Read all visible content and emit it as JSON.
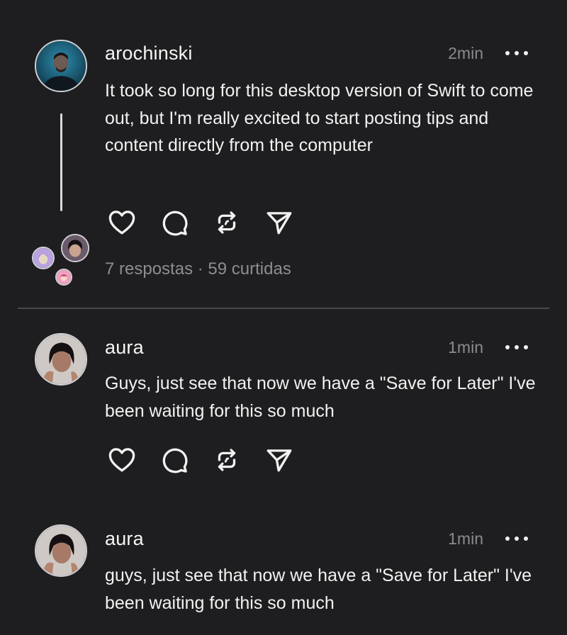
{
  "posts": [
    {
      "username": "arochinski",
      "time": "2min",
      "text": "It took so long for this desktop version of Swift to come out, but I'm really excited to start posting tips and content directly from the computer",
      "stats": {
        "replies": "7 respostas",
        "separator": "·",
        "likes": "59 curtidas"
      }
    },
    {
      "username": "aura",
      "time": "1min",
      "text": "Guys, just see that now we have a \"Save for Later\" I've been waiting for this so much"
    },
    {
      "username": "aura",
      "time": "1min",
      "text": "guys, just see that now we have a \"Save for Later\" I've been waiting for this so much"
    }
  ],
  "icons": {
    "like": "heart-icon",
    "reply": "comment-icon",
    "repost": "repost-icon",
    "share": "send-icon",
    "more": "more-horizontal-icon"
  },
  "colors": {
    "background": "#1e1e20",
    "text": "#f2f2f2",
    "muted": "#8a8a8f",
    "divider": "#4a4a4e"
  }
}
